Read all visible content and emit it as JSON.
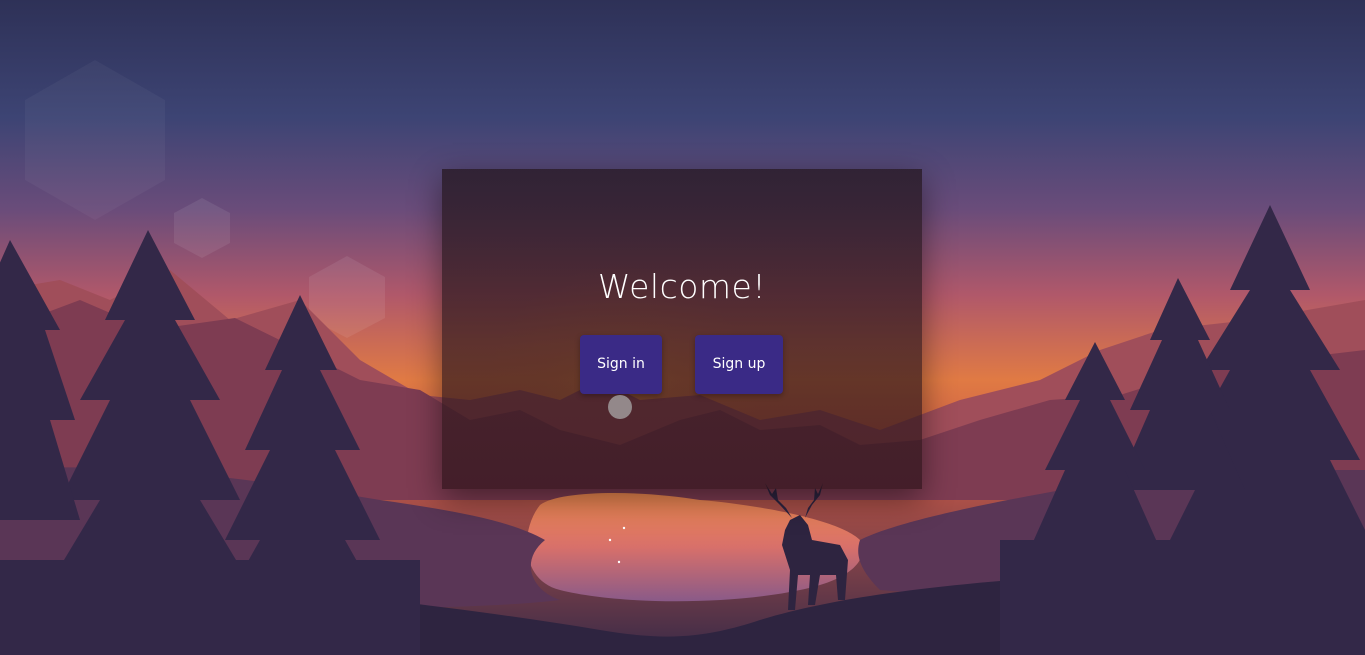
{
  "welcome": {
    "title": "Welcome!",
    "signin_label": "Sign in",
    "signup_label": "Sign up"
  },
  "colors": {
    "button_bg": "#3a2a86",
    "sky_top": "#2e3157",
    "sky_mid": "#6a4c7a",
    "horizon": "#e07a44",
    "foreground": "#2e2440"
  },
  "background": {
    "description_icon": "landscape-sunset-deer"
  }
}
